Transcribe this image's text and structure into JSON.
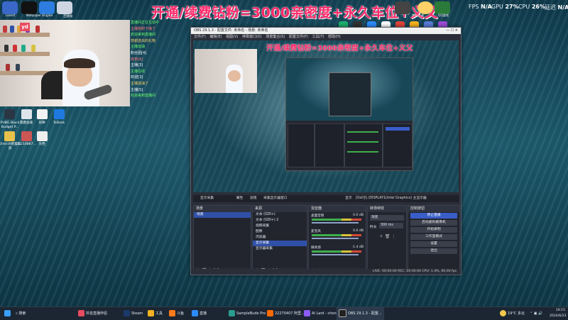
{
  "overlay": {
    "promo_text": "开通/续费钻粉=3000亲密度+永久车位+义父",
    "fps_label": "FPS",
    "fps_value": "N/A",
    "gpu_label": "GPU",
    "gpu_value": "27%",
    "cpu_label": "CPU",
    "cpu_value": "26%",
    "latency_label": "延迟",
    "latency_value": "N/A"
  },
  "top_apps": [
    "Lovart",
    "Wallpaper Engine",
    "回收站",
    "梦幻对决",
    "QQ游戏"
  ],
  "desktop_icons": [
    {
      "label": "PUBG Black Budget P..."
    },
    {
      "label": "雷霆加速"
    },
    {
      "label": "剪映"
    },
    {
      "label": "ToDesk"
    },
    {
      "label": "DirectX修复工具"
    },
    {
      "label": "3b210887..."
    },
    {
      "label": "文档"
    }
  ],
  "chat_lines": [
    "直播间正在互动中",
    "主播刚刚下播了",
    "欢迎来到直播间",
    "感谢送出的礼物",
    "主播加油",
    "粉丝团[4]",
    "房管[6]",
    "主播[3]",
    "主播在线",
    "欢迎[3]",
    "主播加油了",
    "主播[5]",
    "欢迎来到直播间"
  ],
  "obs": {
    "title": "OBS 29.1.3 - 配置文件: 未命名 - 场景: 未命名",
    "menu": [
      "文件(F)",
      "编辑(E)",
      "视图(V)",
      "停靠窗口(D)",
      "场景集合(S)",
      "配置文件(P)",
      "工具(T)",
      "帮助(H)"
    ],
    "source_toolbar": {
      "source": "显示采集",
      "properties": "属性",
      "filters": "滤镜",
      "display": "采集显示器窗口",
      "display2": "显示",
      "monitor": "[0x0]\\\\.\\DISPLAY1(Intel Graphics) 主显示器"
    },
    "scenes": {
      "header": "场景",
      "items": [
        "场景"
      ]
    },
    "sources": {
      "header": "来源",
      "items": [
        "文本 (GDI+)",
        "文本 (GDI+) 2",
        "视频采集",
        "图像",
        "浏览器",
        "显示采集",
        "显示器采集"
      ]
    },
    "mixer": {
      "header": "混音器",
      "channels": [
        {
          "name": "桌面音频",
          "db": "0.0 dB"
        },
        {
          "name": "麦克风",
          "db": "0.0 dB"
        },
        {
          "name": "媒体源",
          "db": "-1.4 dB"
        }
      ]
    },
    "transitions": {
      "header": "转场特效",
      "type": "渐变",
      "duration_label": "时长",
      "duration": "300 ms"
    },
    "controls": {
      "header": "控制按钮",
      "buttons": [
        "停止直播",
        "启动虚拟摄像机",
        "开始录制",
        "工作室模式",
        "设置",
        "退出"
      ]
    },
    "status": "LIVE: 00:00:00    REC: 00:00:00    CPU: 1.4%, 60.00 fps"
  },
  "taskbar": {
    "search_placeholder": "搜索",
    "items": [
      "抖音直播伴侣",
      "Steam",
      "工具",
      "斗鱼",
      "直播",
      "SampleBude Pro ...",
      "22270407 阿里...",
      "AI Lard - chengfe...",
      "OBS 29.1.3 - 配置..."
    ],
    "weather": "19°C 多云",
    "time": "19:15",
    "date": "2024/6/23"
  },
  "colors": {
    "promo": "#ff2a6a",
    "obs_accent": "#3a5ec8",
    "panel_bg": "#22252e"
  }
}
